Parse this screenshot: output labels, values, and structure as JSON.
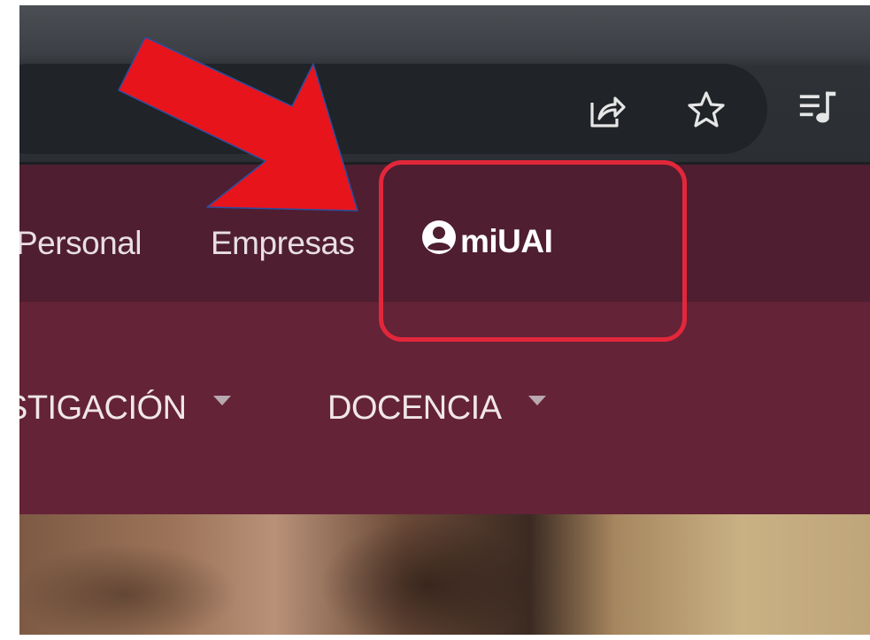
{
  "browser": {
    "icons": [
      "share-icon",
      "star-icon",
      "media-playlist-icon"
    ]
  },
  "site_header": {
    "nav_links": [
      "Personal",
      "Empresas"
    ],
    "account_link": {
      "label": "miUAI",
      "icon": "user-circle-icon"
    }
  },
  "main_menu": {
    "items": [
      "STIGACIÓN",
      "DOCENCIA"
    ]
  },
  "annotation": {
    "arrow_color": "#e8141c",
    "box_color": "#e3273b"
  },
  "colors": {
    "header_top": "#4f1e30",
    "menu_bar": "#642337"
  }
}
